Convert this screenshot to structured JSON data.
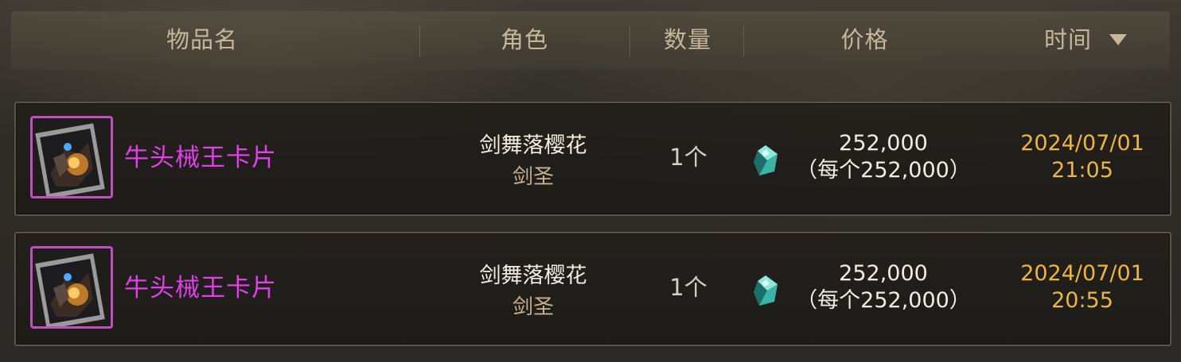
{
  "header": {
    "item_name": "物品名",
    "character": "角色",
    "quantity": "数量",
    "price": "价格",
    "time": "时间",
    "sort_icon": "triangle-down-icon"
  },
  "rows": [
    {
      "item_name": "牛头械王卡片",
      "item_icon": "card-icon",
      "character_name": "剑舞落樱花",
      "character_class": "剑圣",
      "quantity": "1个",
      "currency_icon": "gem-icon",
      "price": "252,000",
      "price_each": "（每个252,000）",
      "date": "2024/07/01",
      "time": "21:05"
    },
    {
      "item_name": "牛头械王卡片",
      "item_icon": "card-icon",
      "character_name": "剑舞落樱花",
      "character_class": "剑圣",
      "quantity": "1个",
      "currency_icon": "gem-icon",
      "price": "252,000",
      "price_each": "（每个252,000）",
      "date": "2024/07/01",
      "time": "20:55"
    }
  ],
  "colors": {
    "item_name": "#e13fe9",
    "item_frame": "#c14fc2",
    "date_time": "#eab543",
    "header_text": "#c7b79a",
    "class_text": "#c6b08e"
  }
}
